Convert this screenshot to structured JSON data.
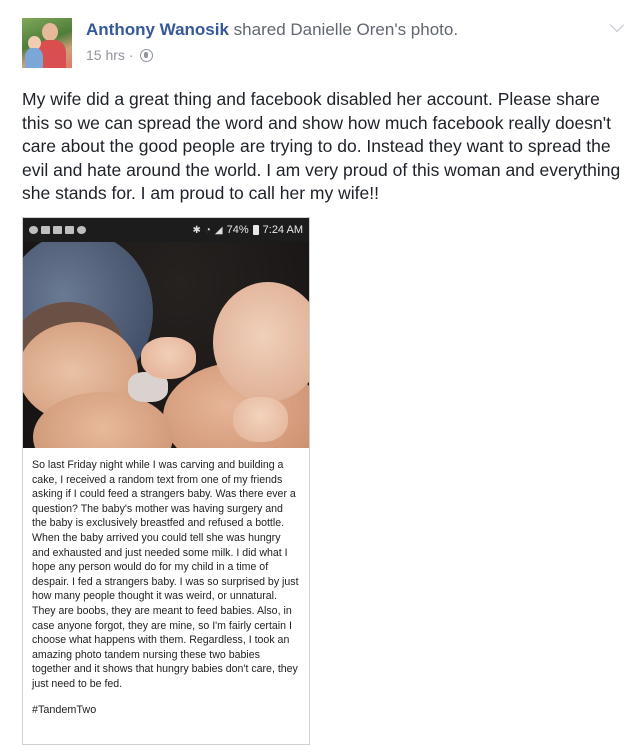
{
  "post": {
    "author": "Anthony Wanosik",
    "shared_text": "shared Danielle Oren's photo.",
    "timestamp": "15 hrs",
    "separator": "·",
    "privacy_icon": "globe-icon",
    "options_icon": "chevron-down-icon",
    "text": "My wife did a great thing and facebook disabled her account. Please share this so we can spread the word and show how much facebook really doesn't care about the good people are trying to do. Instead they want to spread the evil and hate around the world. I am very proud of this woman and everything she stands for. I am proud to call her my wife!!"
  },
  "screenshot": {
    "status_bar": {
      "battery": "74%",
      "time": "7:24 AM"
    },
    "caption": "So last Friday night while I was carving and building a cake, I received a random text from one of my friends asking if I could feed a strangers baby. Was there ever a question? The baby's mother was having surgery and the baby is exclusively breastfed and refused a bottle. When the baby arrived you could tell she was hungry and exhausted and just needed some milk. I did what I hope any person would do for my child in a time of despair. I fed a strangers baby. I was so surprised by just how many people thought it was weird, or unnatural. They are boobs, they are meant to feed babies. Also, in case anyone forgot, they are mine, so I'm fairly certain I choose what happens with them. Regardless, I took an amazing photo tandem nursing these two babies together and it shows that hungry babies don't care, they just need to be fed.",
    "hashtag": "#TandemTwo"
  }
}
